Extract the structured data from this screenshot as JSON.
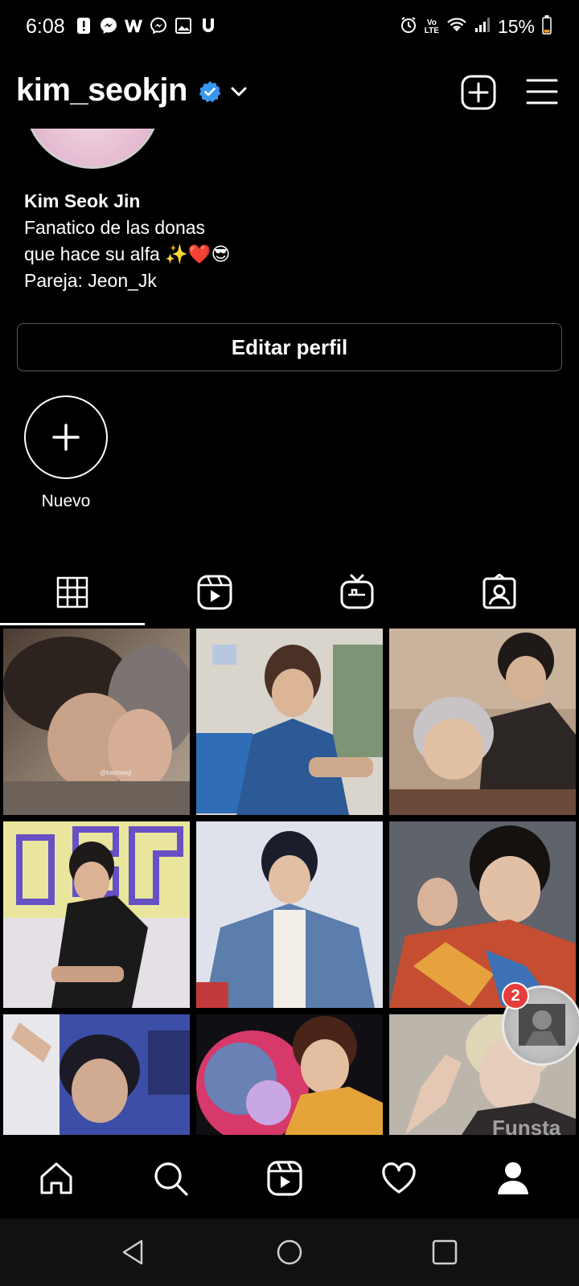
{
  "status_bar": {
    "time": "6:08",
    "battery": "15%",
    "left_icons": [
      "alert-icon",
      "messenger-icon",
      "w-app-icon",
      "messenger-icon",
      "gallery-icon",
      "u-app-icon"
    ],
    "volte_line1": "Vo",
    "volte_line2": "LTE"
  },
  "header": {
    "username": "kim_seokjn",
    "verified": true
  },
  "bio": {
    "name": "Kim Seok Jin",
    "line1": "Fanatico de las donas",
    "line2": "que hace su alfa ✨❤️😎",
    "line3": "Pareja: Jeon_Jk"
  },
  "edit_profile_label": "Editar perfil",
  "highlight": {
    "label": "Nuevo"
  },
  "tabs": [
    "grid-tab",
    "reels-tab",
    "igtv-tab",
    "tagged-tab"
  ],
  "grid": {
    "tile_watermark": "@kaimsegi",
    "tiles": [
      {
        "desc": "illustration-kiss",
        "colors": [
          "#6b5a4e",
          "#a89684",
          "#3a2e27"
        ]
      },
      {
        "desc": "photo-denim-blue",
        "colors": [
          "#d7d3cc",
          "#2a4f86",
          "#c8a888"
        ]
      },
      {
        "desc": "photo-two-people",
        "colors": [
          "#a38f7d",
          "#3a3330",
          "#bfbcbf"
        ]
      },
      {
        "desc": "photo-graffiti",
        "colors": [
          "#e6e1a7",
          "#6a5bbf",
          "#1c1c1c"
        ]
      },
      {
        "desc": "photo-denim-jacket",
        "colors": [
          "#dcdfe9",
          "#6381ad",
          "#f0ede9"
        ]
      },
      {
        "desc": "photo-colorful-shirt",
        "colors": [
          "#6b6f77",
          "#c55036",
          "#e0b49c"
        ]
      },
      {
        "desc": "photo-blue-light",
        "colors": [
          "#3d4fa6",
          "#e6e6ea",
          "#c6a08c"
        ]
      },
      {
        "desc": "photo-planet",
        "colors": [
          "#111118",
          "#d83e6c",
          "#e0a240"
        ]
      },
      {
        "desc": "photo-hand-face",
        "colors": [
          "#bdb6ad",
          "#e3d0c0",
          "#3b3535"
        ]
      }
    ]
  },
  "bubble": {
    "badge": "2",
    "watermark": "Funsta"
  },
  "bottom_nav": [
    "home-icon",
    "search-icon",
    "reels-icon",
    "heart-icon",
    "profile-icon"
  ],
  "colors": {
    "background": "#000000",
    "verified": "#3897f0",
    "badge": "#e63e3e"
  }
}
